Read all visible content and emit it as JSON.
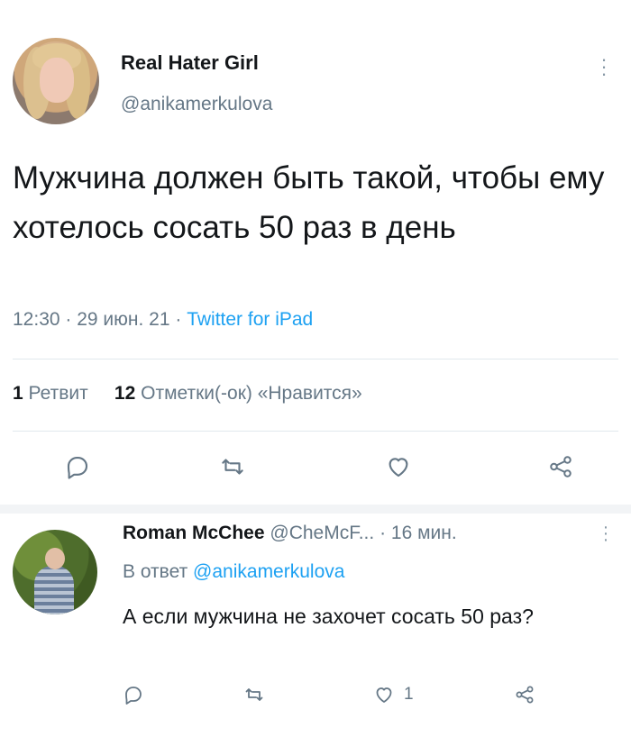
{
  "tweet": {
    "author_name": "Real Hater Girl",
    "author_handle": "@anikamerkulova",
    "text": "Мужчина должен быть такой, чтобы ему хотелось сосать 50 раз в день",
    "time": "12:30 · 29 июн. 21 · ",
    "source": "Twitter for iPad",
    "retweets_count": "1",
    "retweets_label": "Ретвит",
    "likes_count": "12",
    "likes_label": "Отметки(-ок) «Нравится»",
    "actions": [
      "reply-icon",
      "retweet-icon",
      "like-icon",
      "share-icon"
    ]
  },
  "reply": {
    "author_name": "Roman McChee",
    "author_handle": "@CheMcF...",
    "time": "· 16 мин.",
    "reply_to_prefix": "В ответ ",
    "reply_to_handle": "@anikamerkulova",
    "text": "А если мужчина не захочет сосать 50 раз?",
    "like_count": "1",
    "actions": [
      "reply-icon",
      "retweet-icon",
      "like-icon",
      "share-icon"
    ]
  },
  "colors": {
    "accent": "#1da1f2",
    "muted": "#657786",
    "text": "#14171a",
    "divider": "#e1e8ed"
  }
}
